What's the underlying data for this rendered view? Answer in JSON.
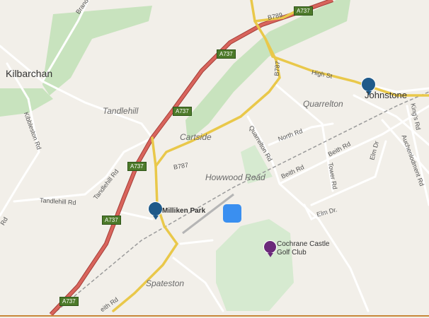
{
  "places": {
    "kilbarchan": "Kilbarchan",
    "tandlehill": "Tandlehill",
    "cartside": "Cartside",
    "howwood_road": "Howwood Road",
    "quarrelton": "Quarrelton",
    "spateston": "Spateston",
    "johnstone": "Johnstone",
    "milliken_park": "Milliken Park",
    "golf_club_line1": "Cochrane Castle",
    "golf_club_line2": "Golf Club"
  },
  "roads": {
    "a737": "A737",
    "b789": "B789",
    "b787": "B787",
    "kibbleston_rd": "Kibbleston Rd",
    "tandlehill_rd": "Tandlehill Rd",
    "quarrelton_rd": "Quarrelton Rd",
    "north_rd": "North Rd",
    "beith_rd": "Beith Rd",
    "beith_rd_2": "Beith Rd",
    "tower_rd": "Tower Rd",
    "elm_dr": "Elm Dr.",
    "elm_dr_2": "Elm Dr",
    "high_st": "High St",
    "kings_rd": "King's Rd",
    "auchenlodment_rd": "Auchenlodment Rd",
    "branch_road": "Brand",
    "bottom_road": "eith Rd",
    "left_edge_road": "Rd"
  },
  "icons": {
    "station": "train-station-icon",
    "golf": "golf-flag-icon",
    "marker": "location-marker"
  },
  "colors": {
    "background": "#f2efe9",
    "woodland": "#c8e3be",
    "motorway": "#c9564f",
    "secondary_road": "#e9c84a",
    "rail": "#9a9a9a",
    "station_pin": "#1f5a8a",
    "golf_pin": "#6b2a7a",
    "marker": "#3a8ff0"
  }
}
